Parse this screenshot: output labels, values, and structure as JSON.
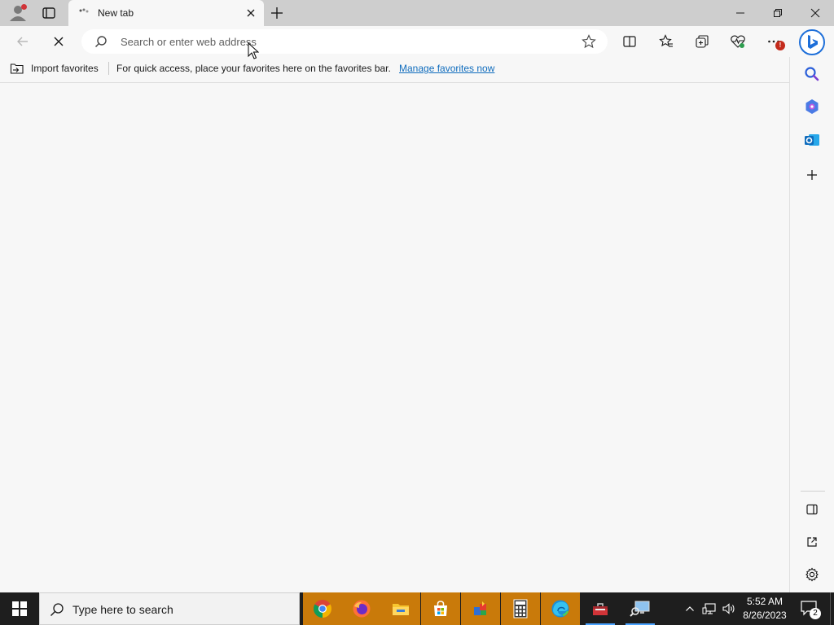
{
  "browser": {
    "tab": {
      "title": "New tab"
    },
    "address_bar": {
      "placeholder": "Search or enter web address",
      "value": ""
    },
    "menu_badge": "!",
    "favorites_bar": {
      "import_label": "Import favorites",
      "message": "For quick access, place your favorites here on the favorites bar.",
      "manage_link": "Manage favorites now"
    }
  },
  "taskbar": {
    "search_placeholder": "Type here to search",
    "clock": {
      "time": "5:52 AM",
      "date": "8/26/2023"
    },
    "notification_count": "2"
  },
  "colors": {
    "titlebar": "#cecece",
    "page_background": "#f7f7f7",
    "link": "#0f6cbd",
    "taskbar": "#1e1e1e",
    "taskbar_pinned_highlight": "#c97a0a"
  }
}
